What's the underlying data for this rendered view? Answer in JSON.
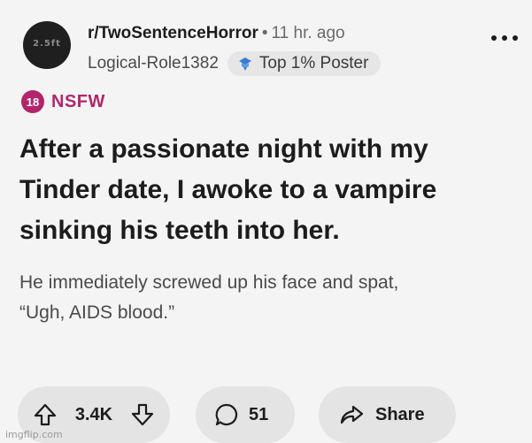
{
  "header": {
    "avatar_text": "2.5ft",
    "subreddit": "r/TwoSentenceHorror",
    "separator": "•",
    "time": "11 hr. ago",
    "author": "Logical-Role1382",
    "badge_label": "Top 1% Poster",
    "badge_icon": "poster-badge-icon",
    "more_icon": "more-options-icon"
  },
  "nsfw": {
    "age": "18",
    "label": "NSFW",
    "color": "#b3256b"
  },
  "post": {
    "title": "After a passionate night with my Tinder date, I awoke to a vampire sinking his teeth into her.",
    "body_line1": "He immediately screwed up his face and spat,",
    "body_line2": "“Ugh, AIDS blood.”"
  },
  "actions": {
    "upvote_icon": "upvote-icon",
    "votes": "3.4K",
    "downvote_icon": "downvote-icon",
    "comment_icon": "comment-icon",
    "comments": "51",
    "share_icon": "share-icon",
    "share_label": "Share"
  },
  "watermark": "imgflip.com"
}
